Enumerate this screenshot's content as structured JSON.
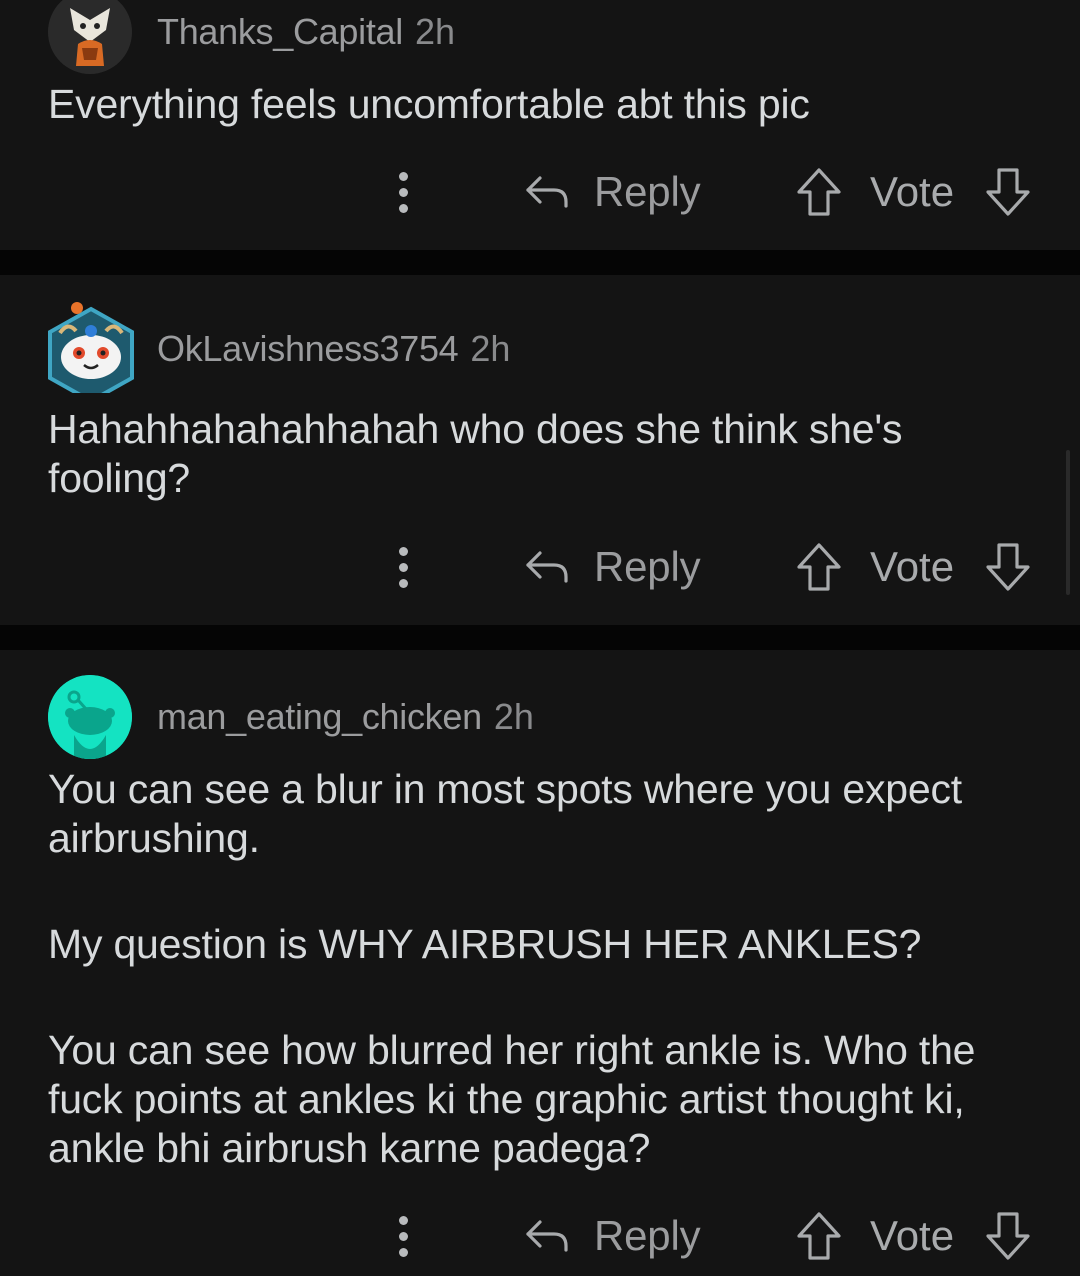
{
  "comments": [
    {
      "username": "Thanks_Capital",
      "time": "2h",
      "body": [
        "Everything feels uncomfortable abt this pic"
      ],
      "reply_label": "Reply",
      "vote_label": "Vote"
    },
    {
      "username": "OkLavishness3754",
      "time": "2h",
      "body": [
        "Hahahhahahahhahah who does she think she's fooling?"
      ],
      "reply_label": "Reply",
      "vote_label": "Vote"
    },
    {
      "username": "man_eating_chicken",
      "time": "2h",
      "body": [
        "You can see a blur in most spots where you expect airbrushing.",
        "My question is WHY AIRBRUSH HER ANKLES?",
        "You can see how blurred her right ankle is. Who the fuck points at ankles ki the graphic artist thought ki, ankle bhi airbrush karne padega?"
      ],
      "reply_label": "Reply",
      "vote_label": "Vote"
    }
  ],
  "colors": {
    "background": "#050505",
    "card": "#141414",
    "text": "#d7dadc",
    "meta_text": "#9b9c9e",
    "avatar_teal": "#14e3c2",
    "avatar_blue_frame": "#2f8fa8"
  }
}
